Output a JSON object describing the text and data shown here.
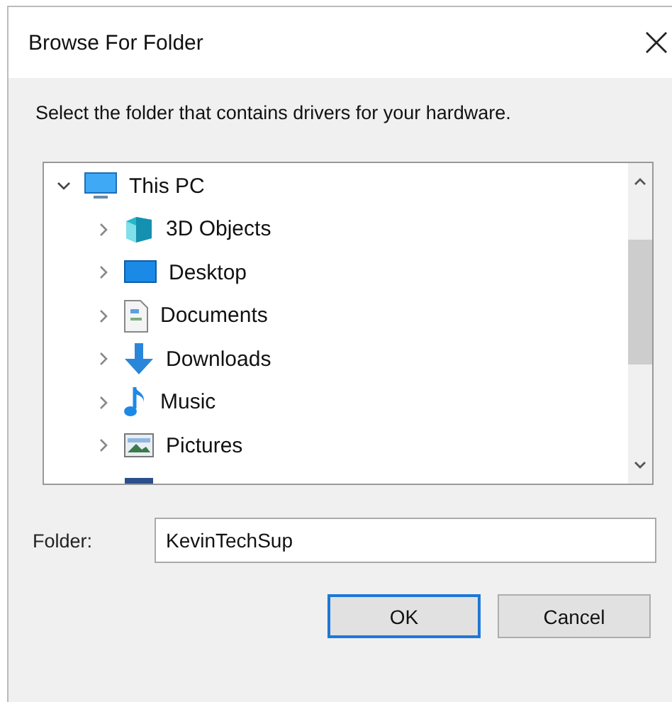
{
  "window": {
    "title": "Browse For Folder"
  },
  "instruction": "Select the folder that contains drivers for your hardware.",
  "tree": [
    {
      "label": "This PC",
      "kind": "pc",
      "expanded": true,
      "children": [
        {
          "label": "3D Objects",
          "kind": "objects",
          "expanded": false
        },
        {
          "label": "Desktop",
          "kind": "desktop",
          "expanded": false
        },
        {
          "label": "Documents",
          "kind": "documents",
          "expanded": false
        },
        {
          "label": "Downloads",
          "kind": "downloads",
          "expanded": false
        },
        {
          "label": "Music",
          "kind": "music",
          "expanded": false
        },
        {
          "label": "Pictures",
          "kind": "pictures",
          "expanded": false
        },
        {
          "kind": "videos"
        }
      ]
    }
  ],
  "folder": {
    "label": "Folder:",
    "value": "KevinTechSup"
  },
  "buttons": [
    {
      "label": "OK",
      "default": true
    },
    {
      "label": "Cancel",
      "default": false
    }
  ]
}
